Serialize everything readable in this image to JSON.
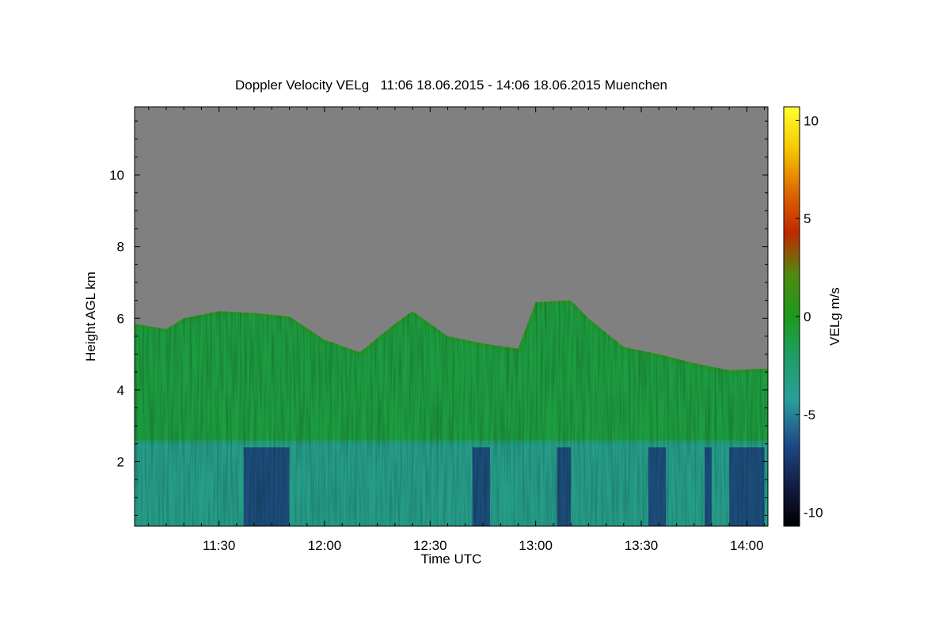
{
  "chart_data": {
    "type": "heatmap",
    "title": "Doppler Velocity VELg   11:06 18.06.2015 - 14:06 18.06.2015 Muenchen",
    "xlabel": "Time UTC",
    "ylabel": "Height AGL km",
    "x_range": [
      "11:06",
      "14:06"
    ],
    "x_ticks": [
      "11:30",
      "12:00",
      "12:30",
      "13:00",
      "13:30",
      "14:00"
    ],
    "y_range": [
      0.2,
      11.9
    ],
    "y_ticks": [
      2,
      4,
      6,
      8,
      10
    ],
    "grid": false,
    "colorbar": {
      "label": "VELg m/s",
      "range": [
        -10.7,
        10.7
      ],
      "ticks": [
        10,
        5,
        0,
        -5,
        -10
      ],
      "colors": [
        "#000000",
        "#141e46",
        "#1e4c8a",
        "#2a9d9a",
        "#1f9e6a",
        "#1c9a1c",
        "#4f8a10",
        "#c02800",
        "#e06a00",
        "#f5c800",
        "#ffff30"
      ]
    },
    "layers": {
      "background_no_signal": "#808080",
      "cloud_top_km": [
        [
          "11:06",
          5.85
        ],
        [
          "11:15",
          5.7
        ],
        [
          "11:20",
          6.0
        ],
        [
          "11:30",
          6.2
        ],
        [
          "11:40",
          6.15
        ],
        [
          "11:50",
          6.05
        ],
        [
          "12:00",
          5.4
        ],
        [
          "12:10",
          5.05
        ],
        [
          "12:20",
          5.85
        ],
        [
          "12:25",
          6.2
        ],
        [
          "12:35",
          5.5
        ],
        [
          "12:45",
          5.3
        ],
        [
          "12:55",
          5.15
        ],
        [
          "13:00",
          6.45
        ],
        [
          "13:10",
          6.5
        ],
        [
          "13:15",
          6.0
        ],
        [
          "13:25",
          5.2
        ],
        [
          "13:35",
          5.0
        ],
        [
          "13:45",
          4.75
        ],
        [
          "13:55",
          4.55
        ],
        [
          "14:06",
          4.6
        ]
      ],
      "melting_layer_km": 2.55,
      "rain_velocity_m_s": -3.5,
      "ice_velocity_m_s": -1.0,
      "strong_downdraft_periods": [
        [
          "11:37",
          "11:50"
        ],
        [
          "12:42",
          "12:47"
        ],
        [
          "13:06",
          "13:10"
        ],
        [
          "13:32",
          "13:37"
        ],
        [
          "13:48",
          "13:50"
        ],
        [
          "13:55",
          "14:05"
        ]
      ]
    }
  }
}
